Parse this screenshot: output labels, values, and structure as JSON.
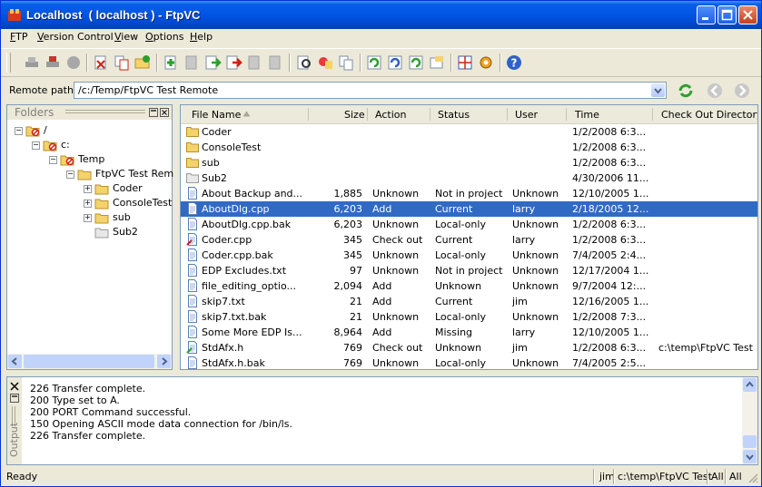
{
  "window": {
    "title": "Localhost  ( localhost ) - FtpVC"
  },
  "menu": [
    {
      "label": "FTP",
      "u": "F",
      "rest": "TP"
    },
    {
      "label": "Version Control",
      "u": "V",
      "rest": "ersion Control"
    },
    {
      "label": "View",
      "u": "V",
      "rest": "iew"
    },
    {
      "label": "Options",
      "u": "O",
      "rest": "ptions"
    },
    {
      "label": "Help",
      "u": "H",
      "rest": "elp"
    }
  ],
  "toolbar_icons": [
    "connect-icon",
    "disconnect-icon",
    "stop-icon",
    "delete-icon",
    "copy-icon",
    "refresh-folder-icon",
    "add-icon",
    "remove-icon",
    "check-in-icon",
    "check-out-icon",
    "get-latest-icon",
    "undo-check-out-icon",
    "find-icon",
    "label-icon",
    "compare-icon",
    "sync-icon",
    "history-icon",
    "properties-icon",
    "settings-icon",
    "grid-icon",
    "help-icon"
  ],
  "remote_path": {
    "label": "Remote path:",
    "value": "/c:/Temp/FtpVC Test Remote"
  },
  "folders": {
    "title": "Folders",
    "tree": [
      {
        "label": "/",
        "level": 0,
        "expander": "-"
      },
      {
        "label": "c:",
        "level": 1,
        "expander": "-"
      },
      {
        "label": "Temp",
        "level": 2,
        "expander": "-"
      },
      {
        "label": "FtpVC Test Remo",
        "level": 3,
        "expander": "-"
      },
      {
        "label": "Coder",
        "level": 4,
        "expander": "+"
      },
      {
        "label": "ConsoleTest",
        "level": 4,
        "expander": "+"
      },
      {
        "label": "sub",
        "level": 4,
        "expander": "+"
      },
      {
        "label": "Sub2",
        "level": 4,
        "expander": ""
      }
    ]
  },
  "file_list": {
    "columns": [
      "File Name",
      "Size",
      "Action",
      "Status",
      "User",
      "Time",
      "Check Out Directory"
    ],
    "rows": [
      {
        "name": "Coder",
        "size": "",
        "action": "",
        "status": "",
        "user": "",
        "time": "1/2/2008 6:3...",
        "dir": "",
        "type": "folder"
      },
      {
        "name": "ConsoleTest",
        "size": "",
        "action": "",
        "status": "",
        "user": "",
        "time": "1/2/2008 6:3...",
        "dir": "",
        "type": "folder"
      },
      {
        "name": "sub",
        "size": "",
        "action": "",
        "status": "",
        "user": "",
        "time": "1/2/2008 6:3...",
        "dir": "",
        "type": "folder"
      },
      {
        "name": "Sub2",
        "size": "",
        "action": "",
        "status": "",
        "user": "",
        "time": "4/30/2006 11...",
        "dir": "",
        "type": "folder-gray"
      },
      {
        "name": "About Backup and...",
        "size": "1,885",
        "action": "Unknown",
        "status": "Not in project",
        "user": "Unknown",
        "time": "12/10/2005 1...",
        "dir": "",
        "type": "file"
      },
      {
        "name": "AboutDlg.cpp",
        "size": "6,203",
        "action": "Add",
        "status": "Current",
        "user": "larry",
        "time": "2/18/2005 12...",
        "dir": "",
        "type": "file",
        "selected": true
      },
      {
        "name": "AboutDlg.cpp.bak",
        "size": "6,203",
        "action": "Unknown",
        "status": "Local-only",
        "user": "Unknown",
        "time": "1/2/2008 6:3...",
        "dir": "",
        "type": "file"
      },
      {
        "name": "Coder.cpp",
        "size": "345",
        "action": "Check out",
        "status": "Current",
        "user": "larry",
        "time": "1/2/2008 6:3...",
        "dir": "",
        "type": "file-red"
      },
      {
        "name": "Coder.cpp.bak",
        "size": "345",
        "action": "Unknown",
        "status": "Local-only",
        "user": "Unknown",
        "time": "7/4/2005 2:4...",
        "dir": "",
        "type": "file"
      },
      {
        "name": "EDP Excludes.txt",
        "size": "97",
        "action": "Unknown",
        "status": "Not in project",
        "user": "Unknown",
        "time": "12/17/2004 1...",
        "dir": "",
        "type": "file"
      },
      {
        "name": "file_editing_optio...",
        "size": "2,094",
        "action": "Add",
        "status": "Unknown",
        "user": "Unknown",
        "time": "9/7/2004 12:...",
        "dir": "",
        "type": "file"
      },
      {
        "name": "skip7.txt",
        "size": "21",
        "action": "Add",
        "status": "Current",
        "user": "jim",
        "time": "12/16/2005 1...",
        "dir": "",
        "type": "file"
      },
      {
        "name": "skip7.txt.bak",
        "size": "21",
        "action": "Unknown",
        "status": "Local-only",
        "user": "Unknown",
        "time": "1/2/2008 7:3...",
        "dir": "",
        "type": "file"
      },
      {
        "name": "Some More EDP Is...",
        "size": "8,964",
        "action": "Add",
        "status": "Missing",
        "user": "larry",
        "time": "12/10/2005 1...",
        "dir": "",
        "type": "file"
      },
      {
        "name": "StdAfx.h",
        "size": "769",
        "action": "Check out",
        "status": "Unknown",
        "user": "jim",
        "time": "1/2/2008 6:3...",
        "dir": "c:\\temp\\FtpVC Test",
        "type": "file-green"
      },
      {
        "name": "StdAfx.h.bak",
        "size": "769",
        "action": "Unknown",
        "status": "Local-only",
        "user": "Unknown",
        "time": "7/4/2005 2:5...",
        "dir": "",
        "type": "file"
      }
    ]
  },
  "output": {
    "title": "Output",
    "lines": [
      "226 Transfer complete.",
      "200 Type set to A.",
      "200 PORT Command successful.",
      "150 Opening ASCII mode data connection for /bin/ls.",
      "226 Transfer complete."
    ]
  },
  "status": {
    "text": "Ready",
    "user": "jim",
    "dir": "c:\\temp\\FtpVC Test",
    "all1": "All",
    "all2": "All"
  },
  "colors": {
    "selection": "#316ac5",
    "titlebar": "#0054e3",
    "folder": "#f5d36b"
  }
}
